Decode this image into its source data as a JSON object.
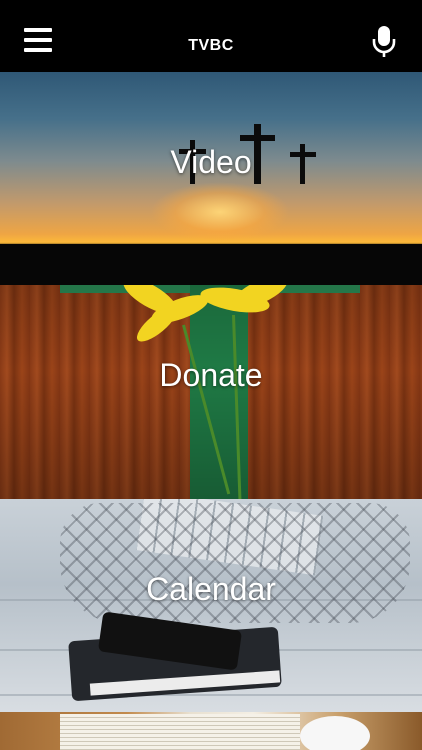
{
  "header": {
    "title": "TVBC",
    "menu_icon": "hamburger-menu-icon",
    "mic_icon": "microphone-icon"
  },
  "tiles": [
    {
      "label": "Video"
    },
    {
      "label": "Donate"
    },
    {
      "label": "Calendar"
    }
  ],
  "colors": {
    "header_bg": "#000000",
    "text": "#ffffff",
    "donate_cross": "#1f7a45",
    "flower": "#f2d421"
  }
}
